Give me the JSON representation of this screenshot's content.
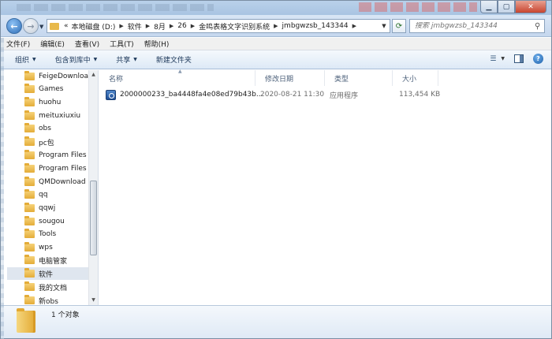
{
  "address": {
    "overflow": "«",
    "crumbs": [
      "本地磁盘 (D:)",
      "软件",
      "8月",
      "26",
      "金鸣表格文字识别系统",
      "jmbgwzsb_143344"
    ]
  },
  "search": {
    "placeholder": "搜索 jmbgwzsb_143344"
  },
  "menu": [
    "文件(F)",
    "编辑(E)",
    "查看(V)",
    "工具(T)",
    "帮助(H)"
  ],
  "toolbar": {
    "organize": "组织",
    "include": "包含到库中",
    "share": "共享",
    "new_folder": "新建文件夹"
  },
  "nav_tree": [
    "FeigeDownloa",
    "Games",
    "huohu",
    "meituxiuxiu",
    "obs",
    "pc包",
    "Program Files",
    "Program Files",
    "QMDownload",
    "qq",
    "qqwj",
    "sougou",
    "Tools",
    "wps",
    "电脑管家",
    "软件",
    "我的文档",
    "新obs"
  ],
  "selected_tree_item": "软件",
  "columns": {
    "name": "名称",
    "modified": "修改日期",
    "type": "类型",
    "size": "大小"
  },
  "files": [
    {
      "name": "2000000233_ba4448fa4e08ed79b43b...",
      "modified": "2020-08-21 11:30",
      "type": "应用程序",
      "size": "113,454 KB"
    }
  ],
  "status": {
    "count": "1 个对象"
  },
  "colors": {
    "accent": "#2e6db6",
    "folder": "#e4ac38"
  }
}
